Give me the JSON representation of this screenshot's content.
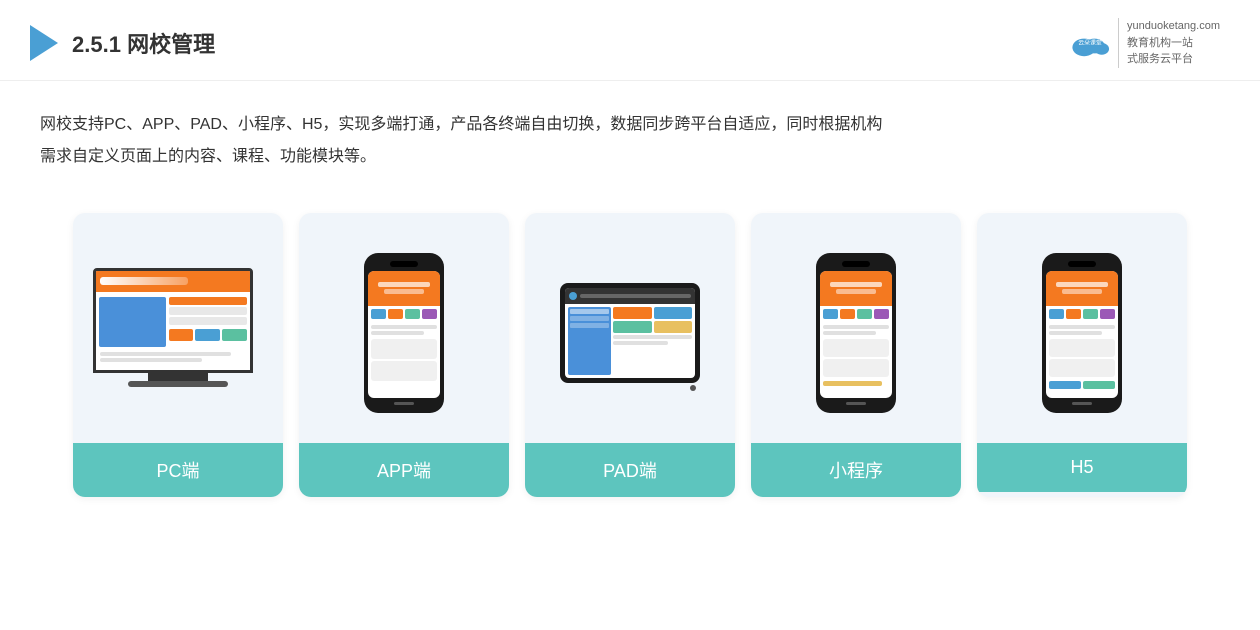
{
  "header": {
    "section_number": "2.5.1",
    "title": "网校管理",
    "brand_name_line1": "yunduoketang.com",
    "brand_name_line2": "教育机构一站",
    "brand_name_line3": "式服务云平台"
  },
  "description": {
    "text_line1": "网校支持PC、APP、PAD、小程序、H5，实现多端打通，产品各终端自由切换，数据同步跨平台自适应，同时根据机构",
    "text_line2": "需求自定义页面上的内容、课程、功能模块等。"
  },
  "cards": [
    {
      "label": "PC端",
      "type": "pc"
    },
    {
      "label": "APP端",
      "type": "phone"
    },
    {
      "label": "PAD端",
      "type": "pad"
    },
    {
      "label": "小程序",
      "type": "phone"
    },
    {
      "label": "H5",
      "type": "phone"
    }
  ]
}
